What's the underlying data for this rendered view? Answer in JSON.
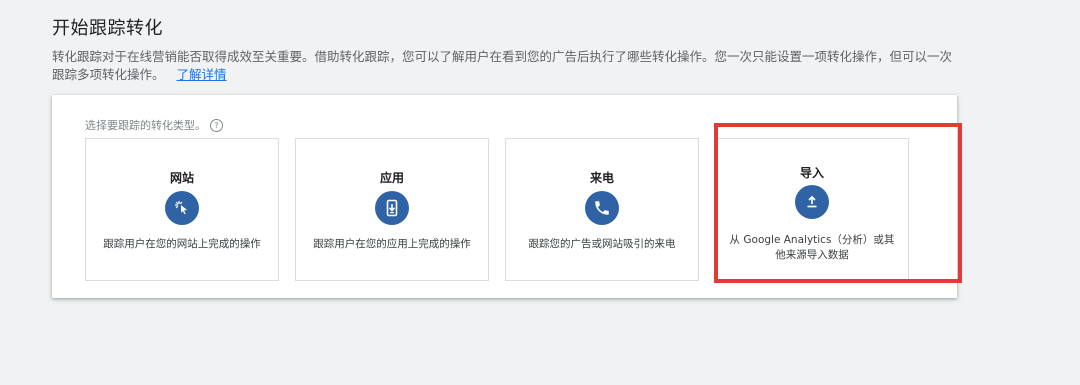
{
  "page": {
    "title": "开始跟踪转化",
    "intro_text": "转化跟踪对于在线营销能否取得成效至关重要。借助转化跟踪，您可以了解用户在看到您的广告后执行了哪些转化操作。您一次只能设置一项转化操作，但可以一次跟踪多项转化操作。",
    "learn_more": "了解详情"
  },
  "panel": {
    "prompt": "选择要跟踪的转化类型。",
    "help_glyph": "?"
  },
  "cards": [
    {
      "title": "网站",
      "icon": "cursor-click-icon",
      "desc": "跟踪用户在您的网站上完成的操作"
    },
    {
      "title": "应用",
      "icon": "phone-download-icon",
      "desc": "跟踪用户在您的应用上完成的操作"
    },
    {
      "title": "来电",
      "icon": "phone-call-icon",
      "desc": "跟踪您的广告或网站吸引的来电"
    },
    {
      "title": "导入",
      "icon": "upload-icon",
      "desc": "从 Google Analytics（分析）或其他来源导入数据"
    }
  ],
  "colors": {
    "icon_bg": "#2f63a5",
    "highlight": "#e53935",
    "link": "#1a73e8"
  }
}
